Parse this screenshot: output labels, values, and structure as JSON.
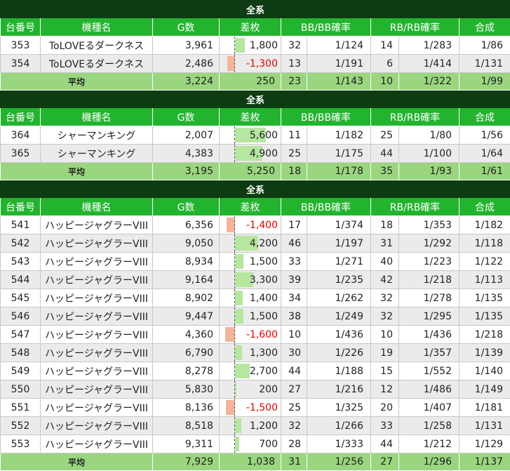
{
  "sections": [
    {
      "banner": "全系",
      "headers": [
        "台番号",
        "機種名",
        "G数",
        "差枚",
        "BB/BB確率",
        "RB/RB確率",
        "合成"
      ],
      "rows": [
        {
          "no": "353",
          "name": "ToLOVEるダークネス",
          "games": "3,961",
          "diff": "1,800",
          "diff_value": 1800,
          "bb": "32",
          "bb_rate": "1/124",
          "rb": "14",
          "rb_rate": "1/283",
          "total": "1/86"
        },
        {
          "no": "354",
          "name": "ToLOVEるダークネス",
          "games": "2,486",
          "diff": "-1,300",
          "diff_value": -1300,
          "bb": "13",
          "bb_rate": "1/191",
          "rb": "6",
          "rb_rate": "1/414",
          "total": "1/131"
        }
      ],
      "average": {
        "label": "平均",
        "games": "3,224",
        "diff": "250",
        "bb": "23",
        "bb_rate": "1/143",
        "rb": "10",
        "rb_rate": "1/322",
        "total": "1/99"
      }
    },
    {
      "banner": "全系",
      "headers": [
        "台番号",
        "機種名",
        "G数",
        "差枚",
        "BB/BB確率",
        "RB/RB確率",
        "合成"
      ],
      "rows": [
        {
          "no": "364",
          "name": "シャーマンキング",
          "games": "2,007",
          "diff": "5,600",
          "diff_value": 5600,
          "bb": "11",
          "bb_rate": "1/182",
          "rb": "25",
          "rb_rate": "1/80",
          "total": "1/56"
        },
        {
          "no": "365",
          "name": "シャーマンキング",
          "games": "4,383",
          "diff": "4,900",
          "diff_value": 4900,
          "bb": "25",
          "bb_rate": "1/175",
          "rb": "44",
          "rb_rate": "1/100",
          "total": "1/64"
        }
      ],
      "average": {
        "label": "平均",
        "games": "3,195",
        "diff": "5,250",
        "bb": "18",
        "bb_rate": "1/178",
        "rb": "35",
        "rb_rate": "1/93",
        "total": "1/61"
      }
    },
    {
      "banner": "全系",
      "headers": [
        "台番号",
        "機種名",
        "G数",
        "差枚",
        "BB/BB確率",
        "RB/RB確率",
        "合成"
      ],
      "rows": [
        {
          "no": "541",
          "name": "ハッピージャグラーVIII",
          "games": "6,356",
          "diff": "-1,400",
          "diff_value": -1400,
          "bb": "17",
          "bb_rate": "1/374",
          "rb": "18",
          "rb_rate": "1/353",
          "total": "1/182"
        },
        {
          "no": "542",
          "name": "ハッピージャグラーVIII",
          "games": "9,050",
          "diff": "4,200",
          "diff_value": 4200,
          "bb": "46",
          "bb_rate": "1/197",
          "rb": "31",
          "rb_rate": "1/292",
          "total": "1/118"
        },
        {
          "no": "543",
          "name": "ハッピージャグラーVIII",
          "games": "8,934",
          "diff": "1,500",
          "diff_value": 1500,
          "bb": "33",
          "bb_rate": "1/271",
          "rb": "40",
          "rb_rate": "1/223",
          "total": "1/122"
        },
        {
          "no": "544",
          "name": "ハッピージャグラーVIII",
          "games": "9,164",
          "diff": "3,300",
          "diff_value": 3300,
          "bb": "39",
          "bb_rate": "1/235",
          "rb": "42",
          "rb_rate": "1/218",
          "total": "1/113"
        },
        {
          "no": "545",
          "name": "ハッピージャグラーVIII",
          "games": "8,902",
          "diff": "1,400",
          "diff_value": 1400,
          "bb": "34",
          "bb_rate": "1/262",
          "rb": "32",
          "rb_rate": "1/278",
          "total": "1/135"
        },
        {
          "no": "546",
          "name": "ハッピージャグラーVIII",
          "games": "9,447",
          "diff": "1,500",
          "diff_value": 1500,
          "bb": "38",
          "bb_rate": "1/249",
          "rb": "32",
          "rb_rate": "1/295",
          "total": "1/135"
        },
        {
          "no": "547",
          "name": "ハッピージャグラーVIII",
          "games": "4,360",
          "diff": "-1,600",
          "diff_value": -1600,
          "bb": "10",
          "bb_rate": "1/436",
          "rb": "10",
          "rb_rate": "1/436",
          "total": "1/218"
        },
        {
          "no": "548",
          "name": "ハッピージャグラーVIII",
          "games": "6,790",
          "diff": "1,300",
          "diff_value": 1300,
          "bb": "30",
          "bb_rate": "1/226",
          "rb": "19",
          "rb_rate": "1/357",
          "total": "1/139"
        },
        {
          "no": "549",
          "name": "ハッピージャグラーVIII",
          "games": "8,278",
          "diff": "2,700",
          "diff_value": 2700,
          "bb": "44",
          "bb_rate": "1/188",
          "rb": "15",
          "rb_rate": "1/552",
          "total": "1/140"
        },
        {
          "no": "550",
          "name": "ハッピージャグラーVIII",
          "games": "5,830",
          "diff": "200",
          "diff_value": 200,
          "bb": "27",
          "bb_rate": "1/216",
          "rb": "12",
          "rb_rate": "1/486",
          "total": "1/149"
        },
        {
          "no": "551",
          "name": "ハッピージャグラーVIII",
          "games": "8,136",
          "diff": "-1,500",
          "diff_value": -1500,
          "bb": "25",
          "bb_rate": "1/325",
          "rb": "20",
          "rb_rate": "1/407",
          "total": "1/181"
        },
        {
          "no": "552",
          "name": "ハッピージャグラーVIII",
          "games": "8,518",
          "diff": "1,200",
          "diff_value": 1200,
          "bb": "32",
          "bb_rate": "1/266",
          "rb": "33",
          "rb_rate": "1/258",
          "total": "1/131"
        },
        {
          "no": "553",
          "name": "ハッピージャグラーVIII",
          "games": "9,311",
          "diff": "700",
          "diff_value": 700,
          "bb": "28",
          "bb_rate": "1/333",
          "rb": "44",
          "rb_rate": "1/212",
          "total": "1/129"
        }
      ],
      "average": {
        "label": "平均",
        "games": "7,929",
        "diff": "1,038",
        "bb": "31",
        "bb_rate": "1/256",
        "rb": "27",
        "rb_rate": "1/296",
        "total": "1/137"
      }
    }
  ],
  "colors": {
    "banner": "#0d3c12",
    "header": "#22b42e",
    "average": "#9ad67f",
    "positive_bar": "#b6e6a0",
    "negative_bar": "#f2b49a",
    "negative_text": "#e00000"
  }
}
